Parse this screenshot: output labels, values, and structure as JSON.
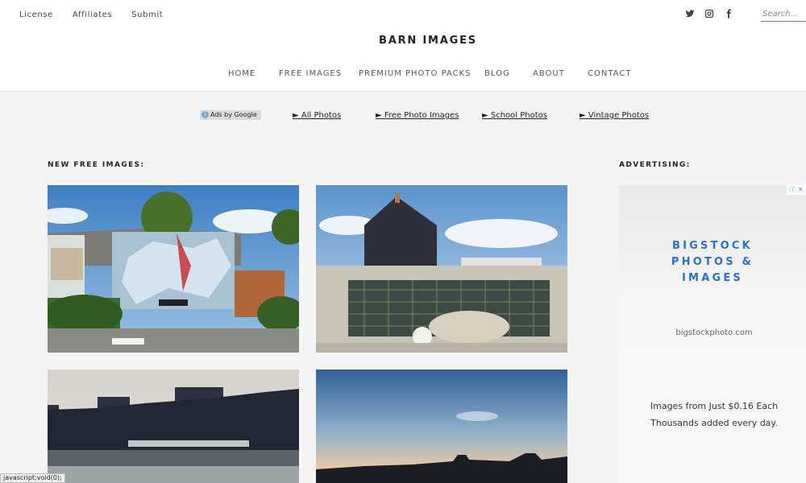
{
  "top_links": [
    "License",
    "Affiliates",
    "Submit"
  ],
  "social_icons": [
    "twitter-icon",
    "instagram-icon",
    "facebook-icon"
  ],
  "search": {
    "placeholder": "Search..."
  },
  "site_title": "BARN IMAGES",
  "main_nav": [
    "HOME",
    "FREE IMAGES",
    "PREMIUM PHOTO PACKS",
    "BLOG",
    "ABOUT",
    "CONTACT"
  ],
  "ads_bar": {
    "label": "Ads by Google",
    "links": [
      "► All Photos",
      "► Free Photo Images",
      "► School Photos",
      "► Vintage Photos"
    ]
  },
  "content": {
    "section_title": "NEW FREE IMAGES:"
  },
  "sidebar": {
    "section_title": "ADVERTISING:",
    "ad": {
      "brand_lines": [
        "BIGSTOCK",
        "PHOTOS &",
        "IMAGES"
      ],
      "url": "bigstockphoto.com",
      "offer_lines": [
        "Images from Just $0.16 Each",
        "Thousands added every day."
      ]
    }
  },
  "status_bar": "javascript:void(0);",
  "colors": {
    "accent": "#2a72c9",
    "page_bg": "#f5f5f5",
    "header_bg": "#ffffff"
  }
}
